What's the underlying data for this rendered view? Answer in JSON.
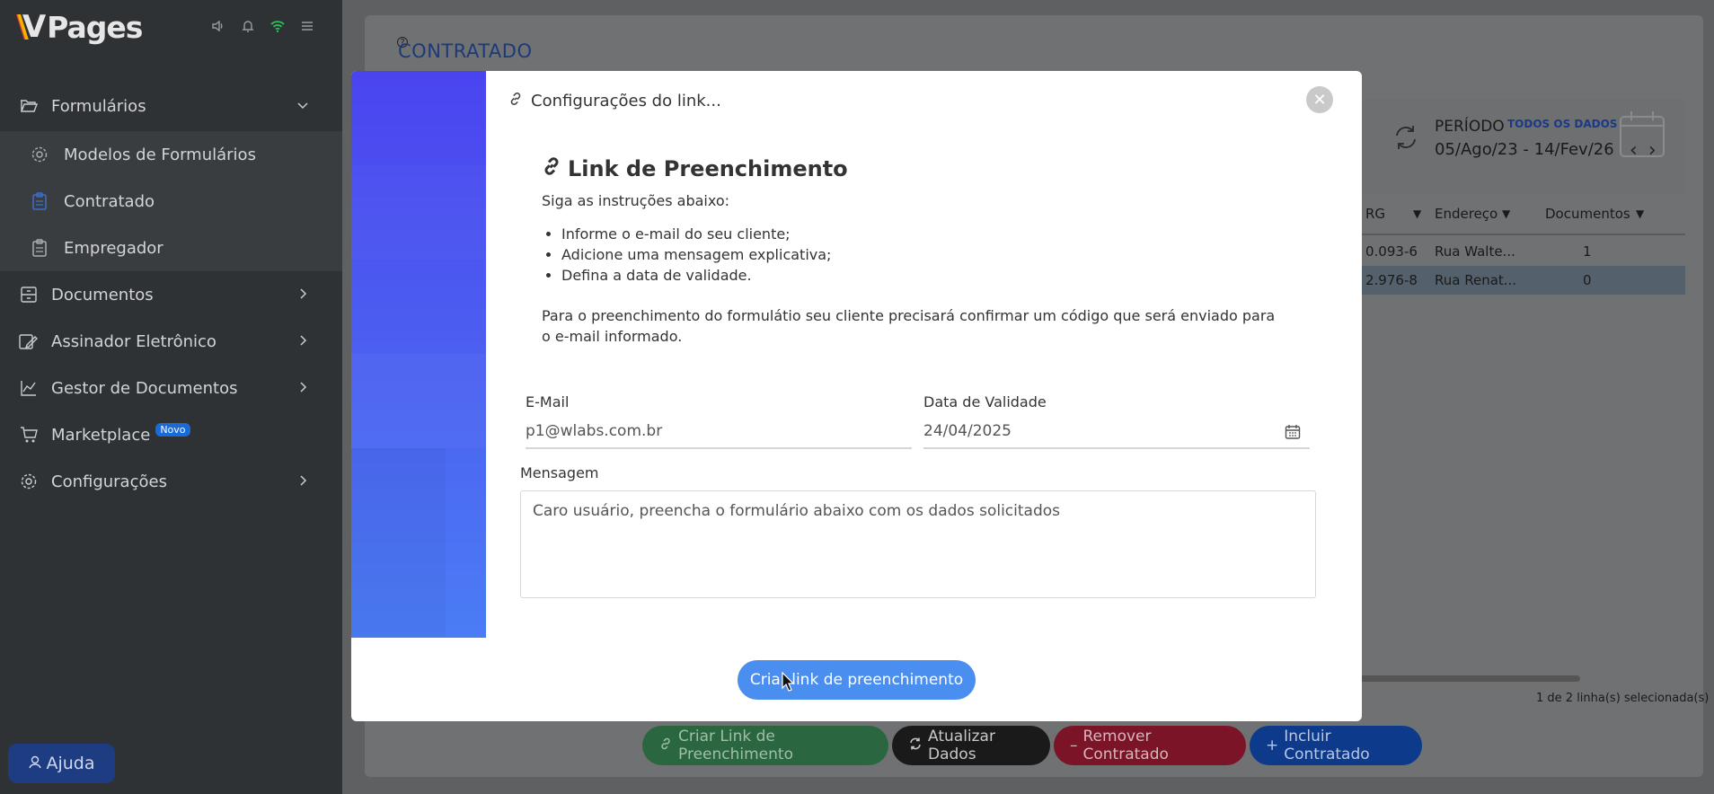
{
  "app": {
    "name": "Pages"
  },
  "sidebar": {
    "items": [
      {
        "label": "Formulários",
        "icon": "folder-open-icon"
      },
      {
        "label": "Modelos de Formulários",
        "icon": "gear-icon"
      },
      {
        "label": "Contratado",
        "icon": "clipboard-icon"
      },
      {
        "label": "Empregador",
        "icon": "clipboard-icon"
      },
      {
        "label": "Documentos",
        "icon": "archive-icon"
      },
      {
        "label": "Assinador Eletrônico",
        "icon": "signature-icon"
      },
      {
        "label": "Gestor de Documentos",
        "icon": "chart-icon"
      },
      {
        "label": "Marketplace",
        "icon": "cart-icon",
        "badge": "Novo"
      },
      {
        "label": "Configurações",
        "icon": "gear-icon"
      }
    ],
    "help_label": "Ajuda"
  },
  "page": {
    "title": "CONTRATADO",
    "period_label": "PERÍODO",
    "period_all": "TODOS OS DADOS",
    "period_range": "05/Ago/23 - 14/Fev/26",
    "columns": [
      "RG",
      "Endereço",
      "Documentos"
    ],
    "rows": [
      {
        "rg": "0.093-6",
        "endereco": "Rua Walte...",
        "documentos": "1"
      },
      {
        "rg": "2.976-8",
        "endereco": "Rua Renat...",
        "documentos": "0"
      }
    ],
    "selection_info": "1 de 2 linha(s) selecionada(s)"
  },
  "actions": {
    "create_link": "Criar Link de Preenchimento",
    "refresh": "Atualizar Dados",
    "remove": "Remover Contratado",
    "add": "Incluir Contratado"
  },
  "modal": {
    "header": "Configurações do link...",
    "title": "Link de Preenchimento",
    "intro": "Siga as instruções abaixo:",
    "steps": [
      "Informe o e-mail do seu cliente;",
      "Adicione uma mensagem explicativa;",
      "Defina a data de validade."
    ],
    "paragraph": "Para o preenchimento do formulátio seu cliente precisará confirmar um código que será enviado para o e-mail informado.",
    "email_label": "E-Mail",
    "email_value": "p1@wlabs.com.br",
    "date_label": "Data de Validade",
    "date_value": "24/04/2025",
    "message_label": "Mensagem",
    "message_value": "Caro usuário, preencha o formulário abaixo com os dados solicitados",
    "submit_label": "Criar link de preenchimento",
    "close_label": "✕"
  },
  "colors": {
    "primary": "#4a8ef0",
    "sidebar_bg": "#2f3235",
    "title_blue": "#1c3a78"
  }
}
